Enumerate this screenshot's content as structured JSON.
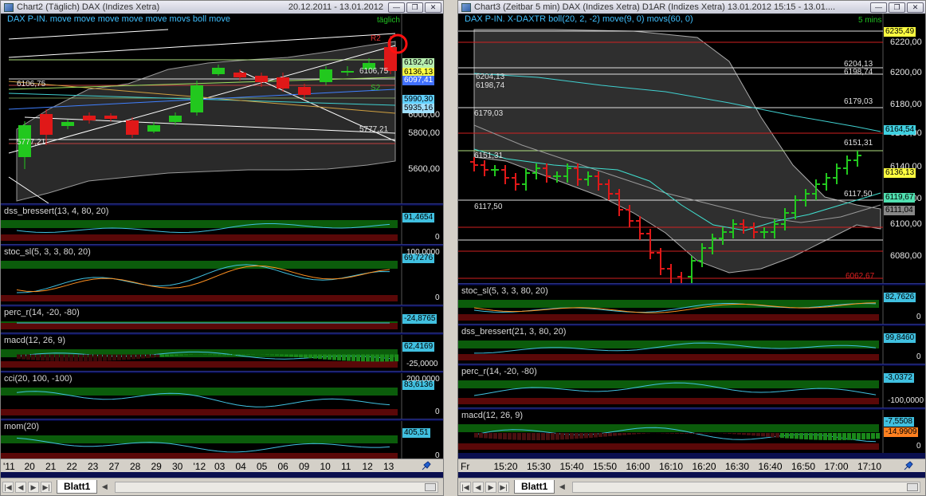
{
  "left": {
    "title": "Chart2 (Täglich)  DAX (Indizes Xetra)",
    "dates": "20.12.2011 - 13.01.2012",
    "main_label": "DAX P-IN. move move move move move movs boll move",
    "interval": "täglich",
    "r2": "R2",
    "s2": "S2",
    "price_tags": [
      "6192,40",
      "6136,13",
      "6097,41",
      "5990,30",
      "5935,16"
    ],
    "axis_ticks": [
      "6000,00",
      "5800,00",
      "5600,00"
    ],
    "line_labels": [
      "6106,75",
      "6106,75",
      "5777,21",
      "5777,21"
    ],
    "indicators": [
      {
        "label": "dss_bressert(13, 4, 80, 20)",
        "value": "91,4654",
        "zero": "0"
      },
      {
        "label": "stoc_sl(5, 3, 3, 80, 20)",
        "value": "69,7276",
        "top": "100,0000",
        "zero": "0"
      },
      {
        "label": "perc_r(14, -20, -80)",
        "value": "-24,8765"
      },
      {
        "label": "macd(12, 26, 9)",
        "value": "62,4169",
        "low": "-25,0000"
      },
      {
        "label": "cci(20, 100, -100)",
        "value": "83,6136",
        "top": "200,0000",
        "zero": "0"
      },
      {
        "label": "mom(20)",
        "value": "405,51",
        "zero": "0"
      }
    ],
    "xlabels": [
      "'11",
      "20",
      "21",
      "22",
      "23",
      "27",
      "28",
      "29",
      "30",
      "'12",
      "03",
      "04",
      "05",
      "06",
      "09",
      "10",
      "11",
      "12",
      "13"
    ],
    "sheet": "Blatt1"
  },
  "right": {
    "title": "Chart3 (Zeitbar 5 min)  DAX (Indizes Xetra) D1AR (Indizes Xetra) 13.01.2012 15:15 - 13.01....",
    "main_label": "DAX P-IN. X-DAXTR boll(20, 2, -2) move(9, 0) movs(60, 0)",
    "interval": "5 mins",
    "axis_ticks": [
      "6220,00",
      "6200,00",
      "6180,00",
      "6160,00",
      "6140,00",
      "6120,00",
      "6100,00",
      "6080,00"
    ],
    "price_tags": [
      "6235,49",
      "6164,54",
      "6136,13",
      "6119,67",
      "6111,04"
    ],
    "line_labels": [
      "6204,13",
      "6198,74",
      "6204,13",
      "6198,74",
      "6179,03",
      "6179,03",
      "6151,31",
      "6151,31",
      "6117,50",
      "6117,50",
      "6062,67"
    ],
    "indicators": [
      {
        "label": "stoc_sl(5, 3, 3, 80, 20)",
        "value": "82,7626",
        "zero": "0"
      },
      {
        "label": "dss_bressert(21, 3, 80, 20)",
        "value": "99,8460",
        "zero": "0"
      },
      {
        "label": "perc_r(14, -20, -80)",
        "value": "-3,0372",
        "low": "-100,0000"
      },
      {
        "label": "macd(12, 26, 9)",
        "value": "-7,5508",
        "value2": "-14,9909",
        "zero": "0"
      }
    ],
    "xlabels": [
      "Fr",
      "15:20",
      "15:30",
      "15:40",
      "15:50",
      "16:00",
      "16:10",
      "16:20",
      "16:30",
      "16:40",
      "16:50",
      "17:00",
      "17:10"
    ],
    "sheet": "Blatt1"
  },
  "colors": {
    "bull": "#22c81e",
    "bear": "#e01818",
    "background": "#000000",
    "panel_bg": "#0a0f4f",
    "green_zone": "#0b5c0b",
    "red_zone": "#5a0808"
  }
}
